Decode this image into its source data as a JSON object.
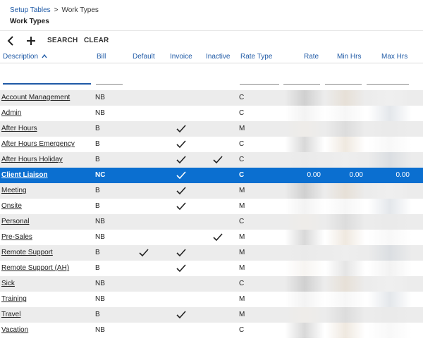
{
  "breadcrumb": {
    "parent": "Setup Tables",
    "separator": ">",
    "current": "Work Types"
  },
  "page_title": "Work Types",
  "toolbar": {
    "search_label": "SEARCH",
    "clear_label": "CLEAR",
    "back_icon": "back-arrow-icon",
    "add_icon": "plus-icon"
  },
  "columns": {
    "description": "Description",
    "sort_indicator": "^",
    "bill": "Bill",
    "default": "Default",
    "invoice": "Invoice",
    "inactive": "Inactive",
    "rate_type": "Rate Type",
    "rate": "Rate",
    "min_hrs": "Min Hrs",
    "max_hrs": "Max Hrs"
  },
  "rows": [
    {
      "description": "Account Management",
      "bill": "NB",
      "default": false,
      "invoice": false,
      "inactive": false,
      "rate_type": "C"
    },
    {
      "description": "Admin",
      "bill": "NB",
      "default": false,
      "invoice": false,
      "inactive": false,
      "rate_type": "C"
    },
    {
      "description": "After Hours",
      "bill": "B",
      "default": false,
      "invoice": true,
      "inactive": false,
      "rate_type": "M"
    },
    {
      "description": "After Hours Emergency",
      "bill": "B",
      "default": false,
      "invoice": true,
      "inactive": false,
      "rate_type": "C"
    },
    {
      "description": "After Hours Holiday",
      "bill": "B",
      "default": false,
      "invoice": true,
      "inactive": true,
      "rate_type": "C"
    },
    {
      "description": "Client Liaison",
      "bill": "NC",
      "default": false,
      "invoice": true,
      "inactive": false,
      "rate_type": "C",
      "rate": "0.00",
      "min_hrs": "0.00",
      "max_hrs": "0.00",
      "selected": true
    },
    {
      "description": "Meeting",
      "bill": "B",
      "default": false,
      "invoice": true,
      "inactive": false,
      "rate_type": "M"
    },
    {
      "description": "Onsite",
      "bill": "B",
      "default": false,
      "invoice": true,
      "inactive": false,
      "rate_type": "M"
    },
    {
      "description": "Personal",
      "bill": "NB",
      "default": false,
      "invoice": false,
      "inactive": false,
      "rate_type": "C"
    },
    {
      "description": "Pre-Sales",
      "bill": "NB",
      "default": false,
      "invoice": false,
      "inactive": true,
      "rate_type": "M"
    },
    {
      "description": "Remote Support",
      "bill": "B",
      "default": true,
      "invoice": true,
      "inactive": false,
      "rate_type": "M"
    },
    {
      "description": "Remote Support (AH)",
      "bill": "B",
      "default": false,
      "invoice": true,
      "inactive": false,
      "rate_type": "M"
    },
    {
      "description": "Sick",
      "bill": "NB",
      "default": false,
      "invoice": false,
      "inactive": false,
      "rate_type": "C"
    },
    {
      "description": "Training",
      "bill": "NB",
      "default": false,
      "invoice": false,
      "inactive": false,
      "rate_type": "M"
    },
    {
      "description": "Travel",
      "bill": "B",
      "default": false,
      "invoice": true,
      "inactive": false,
      "rate_type": "M"
    },
    {
      "description": "Vacation",
      "bill": "NB",
      "default": false,
      "invoice": false,
      "inactive": false,
      "rate_type": "C"
    }
  ],
  "colors": {
    "accent": "#1f5aa6",
    "selected_row": "#0b6fd0",
    "stripe": "#ececec"
  }
}
